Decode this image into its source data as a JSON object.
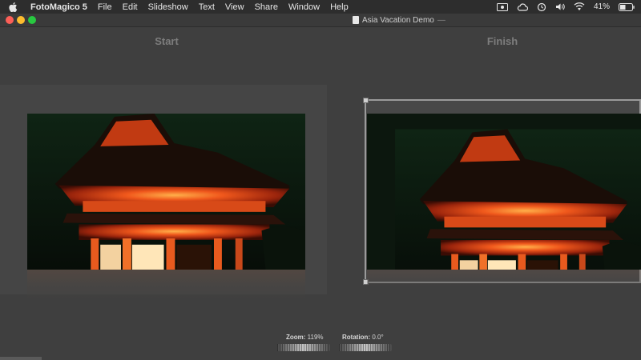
{
  "menubar": {
    "app_name": "FotoMagico 5",
    "items": [
      "File",
      "Edit",
      "Slideshow",
      "Text",
      "View",
      "Share",
      "Window",
      "Help"
    ],
    "status_icons": [
      "screen-record-icon",
      "creative-cloud-icon",
      "time-machine-icon",
      "volume-icon",
      "wifi-icon",
      "battery-icon"
    ],
    "battery_percent": "41%"
  },
  "window": {
    "title": "Asia Vacation Demo",
    "title_suffix": "—"
  },
  "editor": {
    "start_label": "Start",
    "finish_label": "Finish"
  },
  "controls": {
    "zoom_label": "Zoom:",
    "zoom_value": "119%",
    "rotation_label": "Rotation:",
    "rotation_value": "0.0°"
  },
  "colors": {
    "menubar_bg": "#2d2d2d",
    "editor_bg": "#3f3f3f",
    "traffic_red": "#fc5f57",
    "traffic_yellow": "#fdbc2e",
    "traffic_green": "#28c840",
    "temple_orange": "#e8501a"
  }
}
